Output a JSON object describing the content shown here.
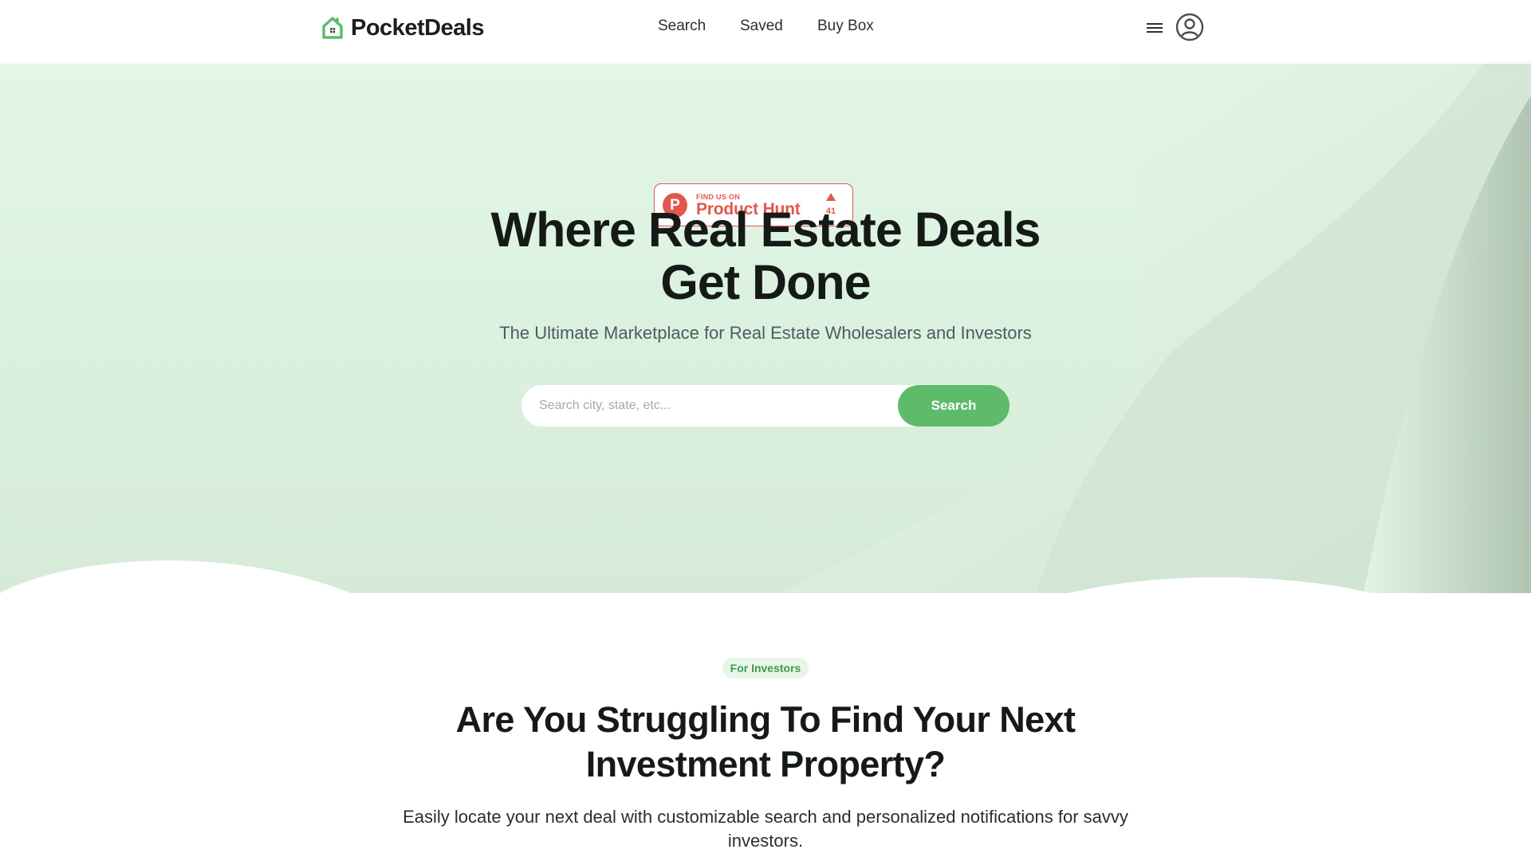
{
  "brand": {
    "name": "PocketDeals",
    "accent": "#5dbb6b"
  },
  "nav": {
    "items": [
      "Search",
      "Saved",
      "Buy Box"
    ]
  },
  "header_icons": {
    "menu": "hamburger-menu-icon",
    "user": "user-account-icon"
  },
  "product_hunt": {
    "small": "FIND US ON",
    "big": "Product Hunt",
    "letter": "P",
    "count": "41",
    "color": "#e2574c"
  },
  "hero": {
    "title": "Where Real Estate Deals Get Done",
    "subtitle": "The Ultimate Marketplace for Real Estate Wholesalers and Investors",
    "search_placeholder": "Search city, state, etc...",
    "search_button": "Search"
  },
  "section": {
    "tag": "For Investors",
    "title": "Are You Struggling To Find Your Next Investment Property?",
    "description": "Easily locate your next deal with customizable search and personalized notifications for savvy investors."
  }
}
